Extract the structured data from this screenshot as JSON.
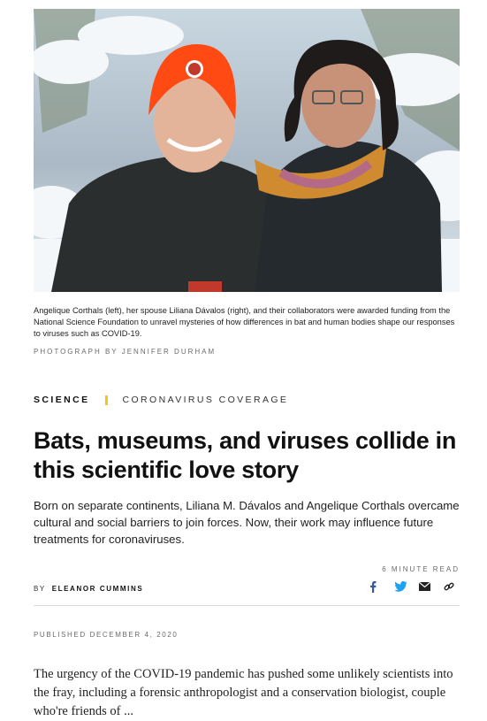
{
  "hero": {
    "caption": "Angelique Corthals (left), her spouse Liliana Dávalos (right), and their collaborators were awarded funding from the National Science Foundation to unravel mysteries of how differences in bat and human bodies shape our responses to viruses such as COVID-19.",
    "credit": "PHOTOGRAPH BY JENNIFER DURHAM"
  },
  "kicker": {
    "section": "SCIENCE",
    "topic": "CORONAVIRUS COVERAGE",
    "accent": "#f5c518"
  },
  "article": {
    "headline": "Bats, museums, and viruses collide in this scientific love story",
    "dek": "Born on separate continents, Liliana M. Dávalos and Angelique Corthals overcame cultural and social barriers to join forces. Now, their work may influence future treatments for coronaviruses.",
    "read_time": "6 MINUTE READ",
    "by_label": "BY",
    "author": "ELEANOR CUMMINS",
    "published": "PUBLISHED DECEMBER 4, 2020",
    "body_first": "The urgency of the COVID-19 pandemic has pushed some unlikely scientists into the fray, including a forensic anthropologist and a conservation biologist, couple who're friends of ..."
  },
  "share": {
    "icons": [
      "facebook-icon",
      "twitter-icon",
      "email-icon",
      "link-icon"
    ],
    "colors": {
      "facebook": "#3b5998",
      "twitter": "#1da1f2",
      "email": "#222222",
      "link": "#222222"
    }
  }
}
